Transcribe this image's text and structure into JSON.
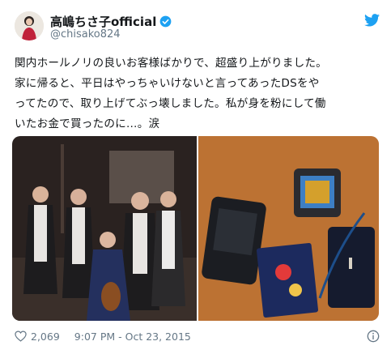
{
  "user": {
    "display_name": "高嶋ちさ子official",
    "handle": "@chisako824"
  },
  "tweet": {
    "lines": [
      "関内ホールノリの良いお客様ばかりで、超盛り上がりました。",
      "家に帰ると、平日はやっちゃいけないと言ってあったDSをや",
      "ってたので、取り上げてぶっ壊しました。私が身を粉にして働",
      "いたお金で買ったのに…。涙"
    ]
  },
  "footer": {
    "likes": "2,069",
    "timestamp": "9:07 PM - Oct 23, 2015"
  },
  "colors": {
    "twitter_blue": "#1da1f2",
    "meta_gray": "#657786"
  },
  "icons": [
    "twitter-bird-icon",
    "verified-badge-icon",
    "heart-icon",
    "info-icon"
  ]
}
